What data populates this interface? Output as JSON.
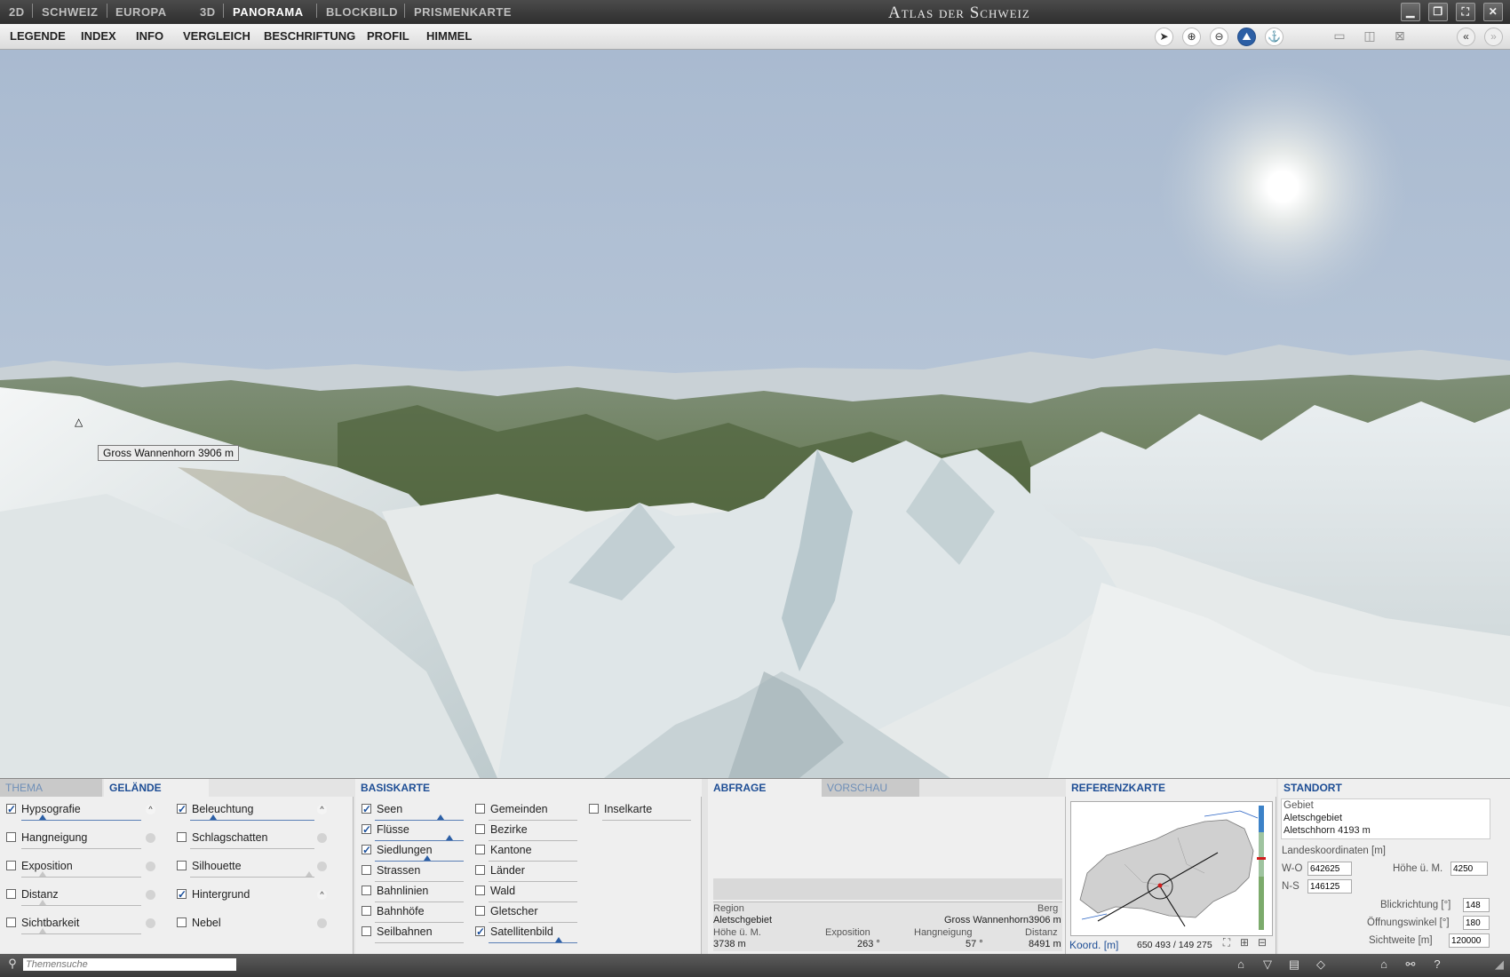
{
  "window": {
    "title": "Atlas der Schweiz",
    "modes_2d": {
      "label": "2D",
      "items": [
        "SCHWEIZ",
        "EUROPA"
      ]
    },
    "modes_3d": {
      "label": "3D",
      "items": [
        "PANORAMA",
        "BLOCKBILD",
        "PRISMENKARTE"
      ]
    },
    "active_mode": "PANORAMA"
  },
  "menu": [
    "LEGENDE",
    "INDEX",
    "INFO",
    "VERGLEICH",
    "BESCHRIFTUNG",
    "PROFIL",
    "HIMMEL"
  ],
  "toolbar_icons": [
    "pointer-icon",
    "zoom-in-icon",
    "zoom-out-icon",
    "terrain-icon",
    "compass-icon",
    "layout-horizontal-icon",
    "layout-vertical-icon",
    "layout-none-icon",
    "collapse-left-icon",
    "collapse-right-icon"
  ],
  "scene": {
    "peak_marker": "△",
    "peak_label": "Gross Wannenhorn   3906 m"
  },
  "gelaende": {
    "tabs": [
      "THEMA",
      "GELÄNDE"
    ],
    "left": [
      {
        "label": "Hypsografie",
        "checked": true,
        "expand": "^"
      },
      {
        "label": "Hangneigung",
        "checked": false
      },
      {
        "label": "Exposition",
        "checked": false
      },
      {
        "label": "Distanz",
        "checked": false
      },
      {
        "label": "Sichtbarkeit",
        "checked": false
      }
    ],
    "right": [
      {
        "label": "Beleuchtung",
        "checked": true,
        "expand": "^"
      },
      {
        "label": "Schlagschatten",
        "checked": false
      },
      {
        "label": "Silhouette",
        "checked": false
      },
      {
        "label": "Hintergrund",
        "checked": true,
        "expand": "^"
      },
      {
        "label": "Nebel",
        "checked": false
      }
    ]
  },
  "basiskarte": {
    "tab": "BASISKARTE",
    "col1": [
      {
        "label": "Seen",
        "checked": true
      },
      {
        "label": "Flüsse",
        "checked": true
      },
      {
        "label": "Siedlungen",
        "checked": true
      },
      {
        "label": "Strassen",
        "checked": false
      },
      {
        "label": "Bahnlinien",
        "checked": false
      },
      {
        "label": "Bahnhöfe",
        "checked": false
      },
      {
        "label": "Seilbahnen",
        "checked": false
      }
    ],
    "col2": [
      {
        "label": "Gemeinden",
        "checked": false
      },
      {
        "label": "Bezirke",
        "checked": false
      },
      {
        "label": "Kantone",
        "checked": false
      },
      {
        "label": "Länder",
        "checked": false
      },
      {
        "label": "Wald",
        "checked": false
      },
      {
        "label": "Gletscher",
        "checked": false
      },
      {
        "label": "Satellitenbild",
        "checked": true
      }
    ],
    "col3": [
      {
        "label": "Inselkarte",
        "checked": false
      }
    ]
  },
  "abfrage": {
    "tabs": [
      "ABFRAGE",
      "VORSCHAU"
    ],
    "region_label": "Region",
    "region_value": "Aletschgebiet",
    "berg_label": "Berg",
    "berg_value": "Gross Wannenhorn",
    "berg_height": "3906 m",
    "hoehe_label": "Höhe ü. M.",
    "hoehe_value": "3738 m",
    "expo_label": "Exposition",
    "expo_value": "263 °",
    "hang_label": "Hangneigung",
    "hang_value": "57 °",
    "dist_label": "Distanz",
    "dist_value": "8491 m"
  },
  "referenzkarte": {
    "tab": "REFERENZKARTE",
    "coord_label": "Koord. [m]",
    "coord_value": "650 493 / 149 275"
  },
  "standort": {
    "tab": "STANDORT",
    "gebiet_label": "Gebiet",
    "gebiet_value": "Aletschgebiet",
    "peak": "Aletschhorn   4193 m",
    "landes_label": "Landeskoordinaten [m]",
    "wo_label": "W-O",
    "wo_value": "642625",
    "ns_label": "N-S",
    "ns_value": "146125",
    "hoehe_label": "Höhe ü. M.",
    "hoehe_value": "4250",
    "blick_label": "Blickrichtung [°]",
    "blick_value": "148",
    "oeff_label": "Öffnungswinkel [°]",
    "oeff_value": "180",
    "sicht_label": "Sichtweite [m]",
    "sicht_value": "120000"
  },
  "statusbar": {
    "search_placeholder": "Themensuche"
  }
}
